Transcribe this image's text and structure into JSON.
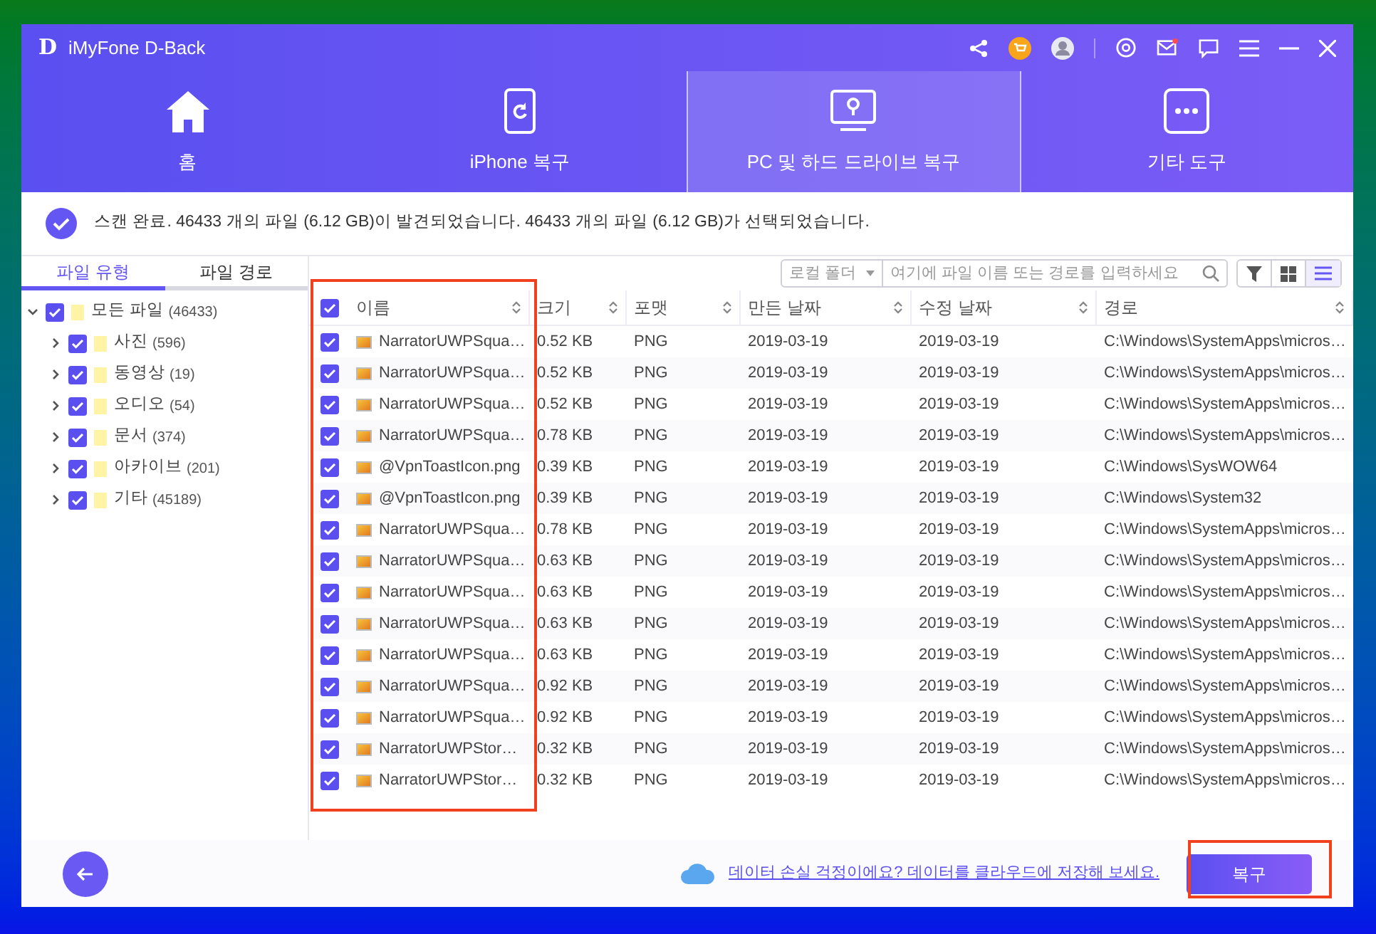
{
  "window": {
    "title": "iMyFone D-Back",
    "logo": "D"
  },
  "nav_tabs": [
    {
      "label": "홈",
      "kind": "home",
      "selected": false
    },
    {
      "label": "iPhone 복구",
      "kind": "phone",
      "selected": false
    },
    {
      "label": "PC 및 하드 드라이브 복구",
      "kind": "monitor",
      "selected": true
    },
    {
      "label": "기타 도구",
      "kind": "tools",
      "selected": false
    }
  ],
  "scan_status": "스캔 완료. 46433 개의 파일 (6.12 GB)이 발견되었습니다. 46433 개의 파일 (6.12 GB)가 선택되었습니다.",
  "sidebar": {
    "tabs": [
      {
        "label": "파일 유형",
        "selected": true
      },
      {
        "label": "파일 경로",
        "selected": false
      }
    ],
    "tree": [
      {
        "label": "모든 파일",
        "count": "(46433)",
        "checked": true,
        "expanded": true,
        "children": [
          {
            "label": "사진",
            "count": "(596)",
            "checked": true,
            "expanded": false
          },
          {
            "label": "동영상",
            "count": "(19)",
            "checked": true,
            "expanded": false
          },
          {
            "label": "오디오",
            "count": "(54)",
            "checked": true,
            "expanded": false
          },
          {
            "label": "문서",
            "count": "(374)",
            "checked": true,
            "expanded": false
          },
          {
            "label": "아카이브",
            "count": "(201)",
            "checked": true,
            "expanded": false
          },
          {
            "label": "기타",
            "count": "(45189)",
            "checked": true,
            "expanded": false
          }
        ]
      }
    ]
  },
  "toolbar": {
    "location": "로컬 폴더",
    "search_placeholder": "여기에 파일 이름 또는 경로를 입력하세요",
    "grid_view_selected": false,
    "list_view_selected": true
  },
  "table": {
    "select_all_checked": true,
    "columns": [
      "이름",
      "크기",
      "포맷",
      "만든 날짜",
      "수정 날짜",
      "경로"
    ],
    "rows": [
      {
        "checked": true,
        "name": "NarratorUWPSqua…",
        "size": "0.52 KB",
        "format": "PNG",
        "created": "2019-03-19",
        "modified": "2019-03-19",
        "path": "C:\\Windows\\SystemApps\\micros…"
      },
      {
        "checked": true,
        "name": "NarratorUWPSqua…",
        "size": "0.52 KB",
        "format": "PNG",
        "created": "2019-03-19",
        "modified": "2019-03-19",
        "path": "C:\\Windows\\SystemApps\\micros…"
      },
      {
        "checked": true,
        "name": "NarratorUWPSqua…",
        "size": "0.52 KB",
        "format": "PNG",
        "created": "2019-03-19",
        "modified": "2019-03-19",
        "path": "C:\\Windows\\SystemApps\\micros…"
      },
      {
        "checked": true,
        "name": "NarratorUWPSqua…",
        "size": "0.78 KB",
        "format": "PNG",
        "created": "2019-03-19",
        "modified": "2019-03-19",
        "path": "C:\\Windows\\SystemApps\\micros…"
      },
      {
        "checked": true,
        "name": "@VpnToastIcon.png",
        "size": "0.39 KB",
        "format": "PNG",
        "created": "2019-03-19",
        "modified": "2019-03-19",
        "path": "C:\\Windows\\SysWOW64"
      },
      {
        "checked": true,
        "name": "@VpnToastIcon.png",
        "size": "0.39 KB",
        "format": "PNG",
        "created": "2019-03-19",
        "modified": "2019-03-19",
        "path": "C:\\Windows\\System32"
      },
      {
        "checked": true,
        "name": "NarratorUWPSqua…",
        "size": "0.78 KB",
        "format": "PNG",
        "created": "2019-03-19",
        "modified": "2019-03-19",
        "path": "C:\\Windows\\SystemApps\\micros…"
      },
      {
        "checked": true,
        "name": "NarratorUWPSqua…",
        "size": "0.63 KB",
        "format": "PNG",
        "created": "2019-03-19",
        "modified": "2019-03-19",
        "path": "C:\\Windows\\SystemApps\\micros…"
      },
      {
        "checked": true,
        "name": "NarratorUWPSqua…",
        "size": "0.63 KB",
        "format": "PNG",
        "created": "2019-03-19",
        "modified": "2019-03-19",
        "path": "C:\\Windows\\SystemApps\\micros…"
      },
      {
        "checked": true,
        "name": "NarratorUWPSqua…",
        "size": "0.63 KB",
        "format": "PNG",
        "created": "2019-03-19",
        "modified": "2019-03-19",
        "path": "C:\\Windows\\SystemApps\\micros…"
      },
      {
        "checked": true,
        "name": "NarratorUWPSqua…",
        "size": "0.63 KB",
        "format": "PNG",
        "created": "2019-03-19",
        "modified": "2019-03-19",
        "path": "C:\\Windows\\SystemApps\\micros…"
      },
      {
        "checked": true,
        "name": "NarratorUWPSqua…",
        "size": "0.92 KB",
        "format": "PNG",
        "created": "2019-03-19",
        "modified": "2019-03-19",
        "path": "C:\\Windows\\SystemApps\\micros…"
      },
      {
        "checked": true,
        "name": "NarratorUWPSqua…",
        "size": "0.92 KB",
        "format": "PNG",
        "created": "2019-03-19",
        "modified": "2019-03-19",
        "path": "C:\\Windows\\SystemApps\\micros…"
      },
      {
        "checked": true,
        "name": "NarratorUWPStor…",
        "size": "0.32 KB",
        "format": "PNG",
        "created": "2019-03-19",
        "modified": "2019-03-19",
        "path": "C:\\Windows\\SystemApps\\micros…"
      },
      {
        "checked": true,
        "name": "NarratorUWPStor…",
        "size": "0.32 KB",
        "format": "PNG",
        "created": "2019-03-19",
        "modified": "2019-03-19",
        "path": "C:\\Windows\\SystemApps\\micros…"
      }
    ]
  },
  "footer": {
    "cloud_link": "데이터 손실 걱정이에요? 데이터를 클라우드에 저장해 보세요.",
    "recover_button": "복구"
  }
}
